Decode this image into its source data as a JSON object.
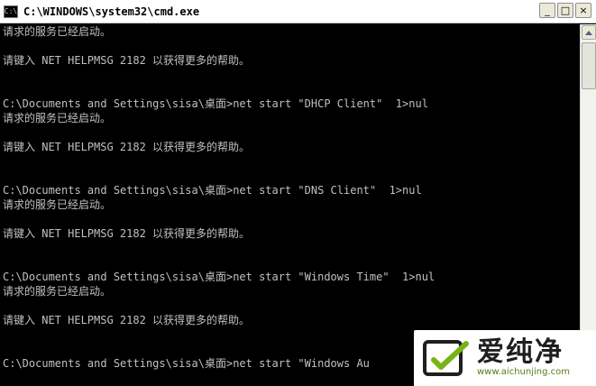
{
  "window": {
    "title": "C:\\WINDOWS\\system32\\cmd.exe",
    "icon_text": "C:\\",
    "buttons": {
      "minimize": "_",
      "maximize": "□",
      "close": "×"
    }
  },
  "console": {
    "text_color": "#c0c0c0",
    "background": "#000000",
    "lines": [
      "请求的服务已经启动。",
      "",
      "请键入 NET HELPMSG 2182 以获得更多的帮助。",
      "",
      "",
      "C:\\Documents and Settings\\sisa\\桌面>net start \"DHCP Client\"  1>nul",
      "请求的服务已经启动。",
      "",
      "请键入 NET HELPMSG 2182 以获得更多的帮助。",
      "",
      "",
      "C:\\Documents and Settings\\sisa\\桌面>net start \"DNS Client\"  1>nul",
      "请求的服务已经启动。",
      "",
      "请键入 NET HELPMSG 2182 以获得更多的帮助。",
      "",
      "",
      "C:\\Documents and Settings\\sisa\\桌面>net start \"Windows Time\"  1>nul",
      "请求的服务已经启动。",
      "",
      "请键入 NET HELPMSG 2182 以获得更多的帮助。",
      "",
      "",
      "C:\\Documents and Settings\\sisa\\桌面>net start \"Windows Au"
    ]
  },
  "watermark": {
    "name": "爱纯净",
    "url": "www.aichunjing.com",
    "accent": "#7ab317"
  }
}
